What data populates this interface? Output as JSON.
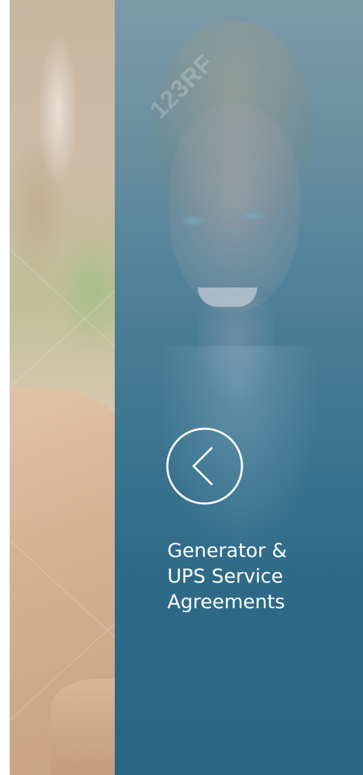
{
  "watermark": {
    "text": "123RF"
  },
  "panel": {
    "back_icon": "chevron-left-circle-icon",
    "title_lines": [
      "Generator &",
      "UPS Service",
      "Agreements"
    ]
  },
  "colors": {
    "panel_top": "#7d9aa8",
    "panel_bottom": "#2a6584",
    "text": "#ffffff"
  }
}
